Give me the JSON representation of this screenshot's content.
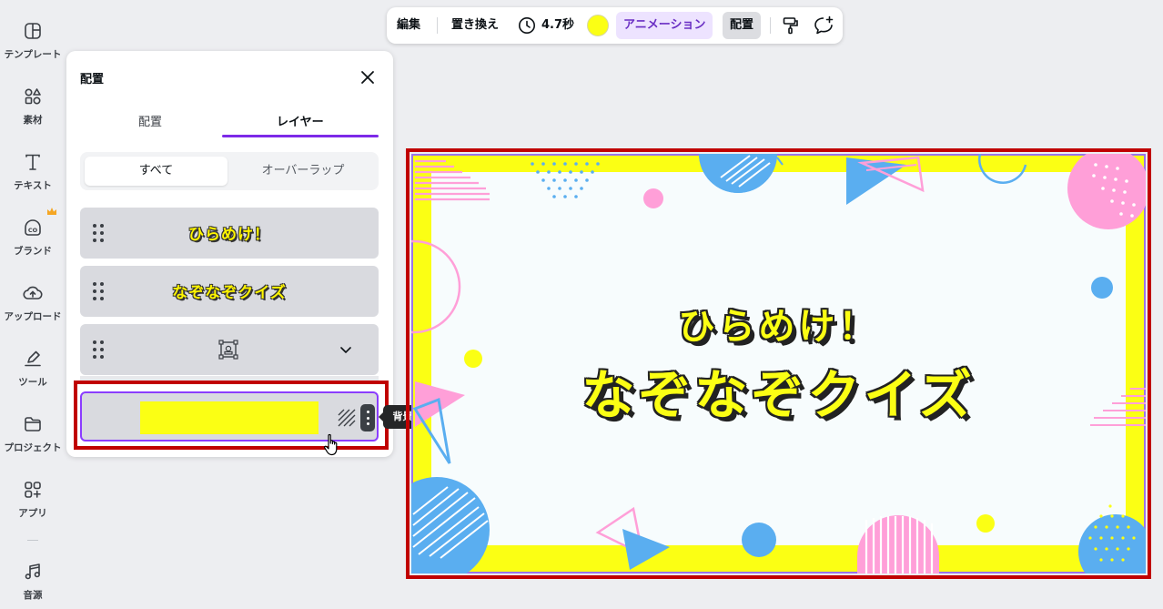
{
  "sidebar": {
    "items": [
      {
        "label": "テンプレート",
        "icon": "template-icon"
      },
      {
        "label": "素材",
        "icon": "elements-icon"
      },
      {
        "label": "テキスト",
        "icon": "text-icon"
      },
      {
        "label": "ブランド",
        "icon": "brand-icon"
      },
      {
        "label": "アップロード",
        "icon": "upload-icon"
      },
      {
        "label": "ツール",
        "icon": "draw-tool-icon"
      },
      {
        "label": "プロジェクト",
        "icon": "folder-icon"
      },
      {
        "label": "アプリ",
        "icon": "apps-icon"
      },
      {
        "label": "音源",
        "icon": "music-icon"
      }
    ]
  },
  "toolbar": {
    "edit": "編集",
    "replace": "置き換え",
    "duration": "4.7秒",
    "color": "#fbff14",
    "animation": "アニメーション",
    "arrange": "配置"
  },
  "panel": {
    "title": "配置",
    "tabs": [
      {
        "label": "配置",
        "active": false
      },
      {
        "label": "レイヤー",
        "active": true
      }
    ],
    "filter": {
      "all": "すべて",
      "overlap": "オーバーラップ"
    },
    "layers": [
      {
        "type": "text",
        "text": "ひらめけ！"
      },
      {
        "type": "text",
        "text": "なぞなぞクイズ"
      },
      {
        "type": "group"
      },
      {
        "type": "background",
        "color": "#fbff14",
        "tooltip": "背景"
      }
    ]
  },
  "canvas": {
    "line1": "ひらめけ！",
    "line2": "なぞなぞクイズ",
    "frame_color": "#fbff14",
    "colors": {
      "blue": "#5aaef0",
      "pink": "#ff9fd8"
    }
  },
  "highlight_color": "#c00000"
}
